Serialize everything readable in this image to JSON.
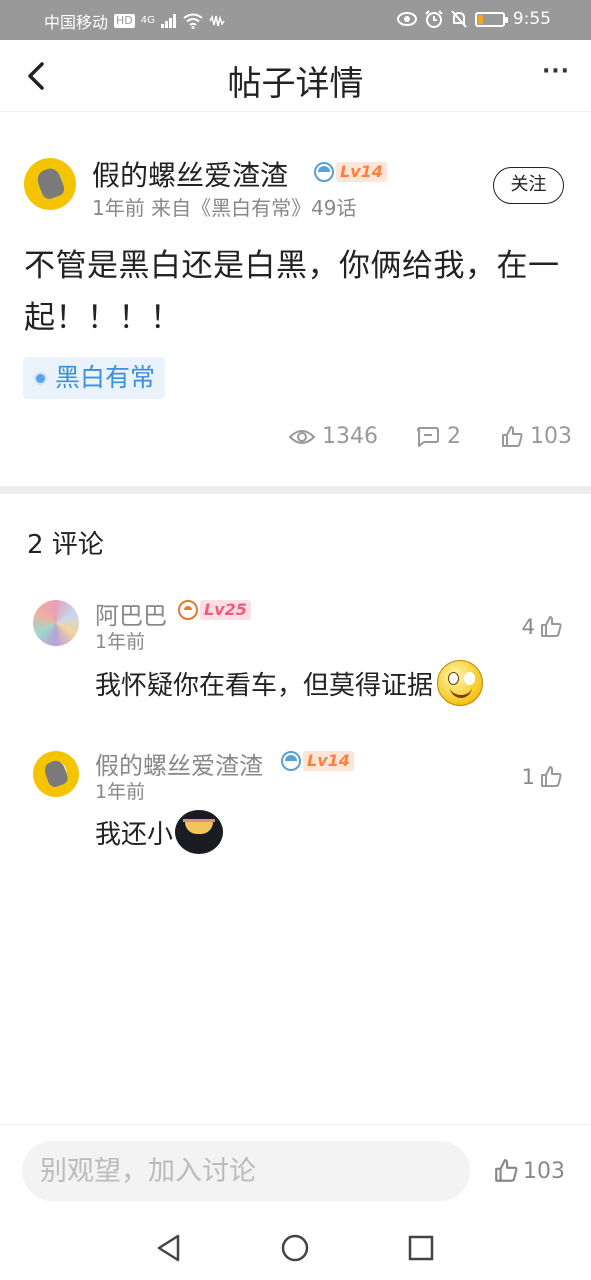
{
  "status_bar": {
    "carrier": "中国移动",
    "hd": "HD",
    "network": "4G",
    "time": "9:55",
    "battery_level": 0.2
  },
  "header": {
    "title": "帖子详情",
    "back_icon": "chevron-left-icon",
    "more_icon": "more-horizontal-icon",
    "more_label": "···"
  },
  "post": {
    "author": "假的螺丝爱渣渣",
    "level": "Lv14",
    "meta": "1年前 来自《黑白有常》49话",
    "follow_label": "关注",
    "content": "不管是黑白还是白黑，你俩给我，在一起！！！！",
    "topic": "黑白有常",
    "views": "1346",
    "comments": "2",
    "likes": "103"
  },
  "comments_header": "2 评论",
  "comments": [
    {
      "author": "阿巴巴",
      "level": "Lv25",
      "time": "1年前",
      "text": "我怀疑你在看车，但莫得证据",
      "likes": "4",
      "emoji": "smile-emoji"
    },
    {
      "author": "假的螺丝爱渣渣",
      "level": "Lv14",
      "time": "1年前",
      "text": "我还小",
      "likes": "1",
      "emoji": "dark-emoji"
    }
  ],
  "bottom": {
    "input_placeholder": "别观望，加入讨论",
    "likes": "103"
  },
  "colors": {
    "accent_blue": "#3b8fdc",
    "level_orange": "#ff7f3f",
    "level_pink": "#f25a7a"
  }
}
